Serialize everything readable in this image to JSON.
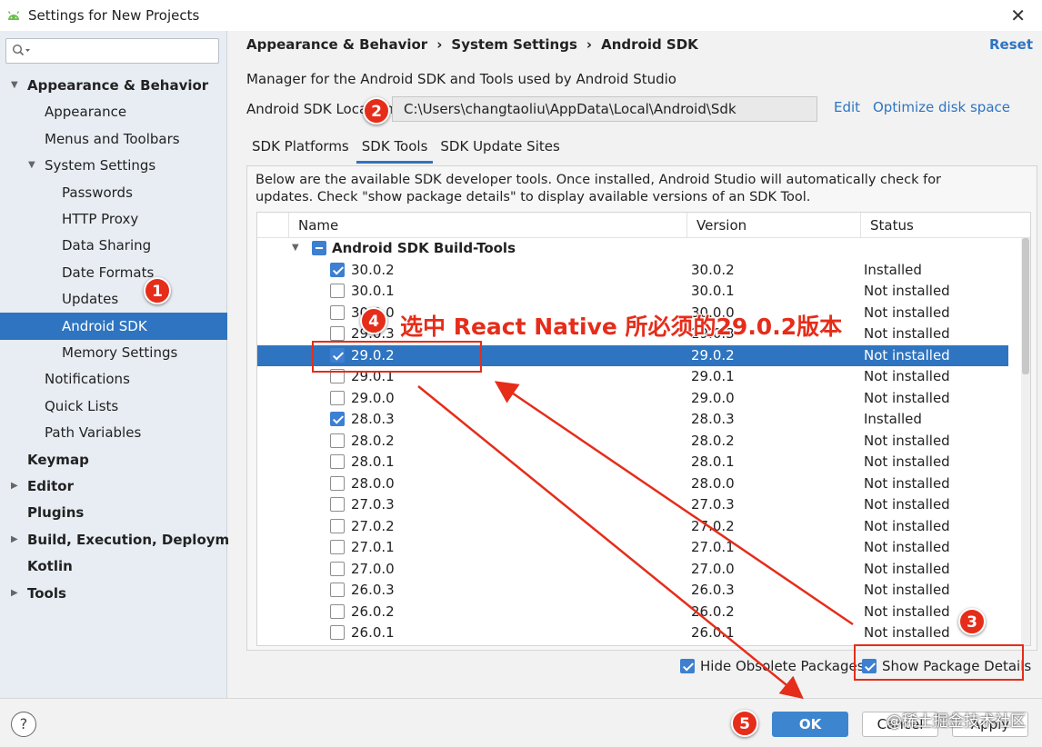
{
  "window": {
    "title": "Settings for New Projects"
  },
  "search": {
    "placeholder": ""
  },
  "sidebar": {
    "items": [
      {
        "label": "Appearance & Behavior",
        "level": 0,
        "bold": true,
        "expanded": true
      },
      {
        "label": "Appearance",
        "level": 1
      },
      {
        "label": "Menus and Toolbars",
        "level": 1
      },
      {
        "label": "System Settings",
        "level": 1,
        "expanded": true
      },
      {
        "label": "Passwords",
        "level": 2
      },
      {
        "label": "HTTP Proxy",
        "level": 2
      },
      {
        "label": "Data Sharing",
        "level": 2
      },
      {
        "label": "Date Formats",
        "level": 2
      },
      {
        "label": "Updates",
        "level": 2
      },
      {
        "label": "Android SDK",
        "level": 2,
        "selected": true
      },
      {
        "label": "Memory Settings",
        "level": 2
      },
      {
        "label": "Notifications",
        "level": 1
      },
      {
        "label": "Quick Lists",
        "level": 1
      },
      {
        "label": "Path Variables",
        "level": 1
      },
      {
        "label": "Keymap",
        "level": 0,
        "bold": true
      },
      {
        "label": "Editor",
        "level": 0,
        "bold": true,
        "collapsed": true
      },
      {
        "label": "Plugins",
        "level": 0,
        "bold": true
      },
      {
        "label": "Build, Execution, Deployment",
        "level": 0,
        "bold": true,
        "collapsed": true
      },
      {
        "label": "Kotlin",
        "level": 0,
        "bold": true
      },
      {
        "label": "Tools",
        "level": 0,
        "bold": true,
        "collapsed": true
      }
    ]
  },
  "header": {
    "breadcrumb": [
      "Appearance & Behavior",
      "System Settings",
      "Android SDK"
    ],
    "breadcrumb_sep": "›",
    "reset_label": "Reset"
  },
  "main": {
    "description": "Manager for the Android SDK and Tools used by Android Studio",
    "location_label": "Android SDK Location:",
    "location_value": "C:\\Users\\changtaoliu\\AppData\\Local\\Android\\Sdk",
    "edit_label": "Edit",
    "optimize_label": "Optimize disk space",
    "tabs": [
      "SDK Platforms",
      "SDK Tools",
      "SDK Update Sites"
    ],
    "active_tab": "SDK Tools",
    "panel_description": "Below are the available SDK developer tools. Once installed, Android Studio will automatically check for updates. Check \"show package details\" to display available versions of an SDK Tool."
  },
  "table": {
    "columns": [
      "Name",
      "Version",
      "Status"
    ],
    "group": {
      "label": "Android SDK Build-Tools"
    },
    "rows": [
      {
        "name": "30.0.2",
        "version": "30.0.2",
        "status": "Installed",
        "checked": true
      },
      {
        "name": "30.0.1",
        "version": "30.0.1",
        "status": "Not installed",
        "checked": false
      },
      {
        "name": "30.0.0",
        "version": "30.0.0",
        "status": "Not installed",
        "checked": false
      },
      {
        "name": "29.0.3",
        "version": "29.0.3",
        "status": "Not installed",
        "checked": false
      },
      {
        "name": "29.0.2",
        "version": "29.0.2",
        "status": "Not installed",
        "checked": true,
        "selected": true
      },
      {
        "name": "29.0.1",
        "version": "29.0.1",
        "status": "Not installed",
        "checked": false
      },
      {
        "name": "29.0.0",
        "version": "29.0.0",
        "status": "Not installed",
        "checked": false
      },
      {
        "name": "28.0.3",
        "version": "28.0.3",
        "status": "Installed",
        "checked": true
      },
      {
        "name": "28.0.2",
        "version": "28.0.2",
        "status": "Not installed",
        "checked": false
      },
      {
        "name": "28.0.1",
        "version": "28.0.1",
        "status": "Not installed",
        "checked": false
      },
      {
        "name": "28.0.0",
        "version": "28.0.0",
        "status": "Not installed",
        "checked": false
      },
      {
        "name": "27.0.3",
        "version": "27.0.3",
        "status": "Not installed",
        "checked": false
      },
      {
        "name": "27.0.2",
        "version": "27.0.2",
        "status": "Not installed",
        "checked": false
      },
      {
        "name": "27.0.1",
        "version": "27.0.1",
        "status": "Not installed",
        "checked": false
      },
      {
        "name": "27.0.0",
        "version": "27.0.0",
        "status": "Not installed",
        "checked": false
      },
      {
        "name": "26.0.3",
        "version": "26.0.3",
        "status": "Not installed",
        "checked": false
      },
      {
        "name": "26.0.2",
        "version": "26.0.2",
        "status": "Not installed",
        "checked": false
      },
      {
        "name": "26.0.1",
        "version": "26.0.1",
        "status": "Not installed",
        "checked": false
      }
    ]
  },
  "options": {
    "hide_obsolete": {
      "label": "Hide Obsolete Packages",
      "checked": true
    },
    "show_details": {
      "label": "Show Package Details",
      "checked": true
    }
  },
  "footer": {
    "help_label": "?",
    "ok_label": "OK",
    "cancel_label": "Cancel",
    "apply_label": "Apply"
  },
  "annotations": {
    "badges": [
      "1",
      "2",
      "3",
      "4",
      "5"
    ],
    "note": "选中 React Native 所必须的29.0.2版本",
    "watermark": "@稀土掘金技术社区"
  },
  "colors": {
    "accent": "#2f74c0",
    "annotation": "#e52d1a",
    "primary_button": "#3d86cf"
  }
}
